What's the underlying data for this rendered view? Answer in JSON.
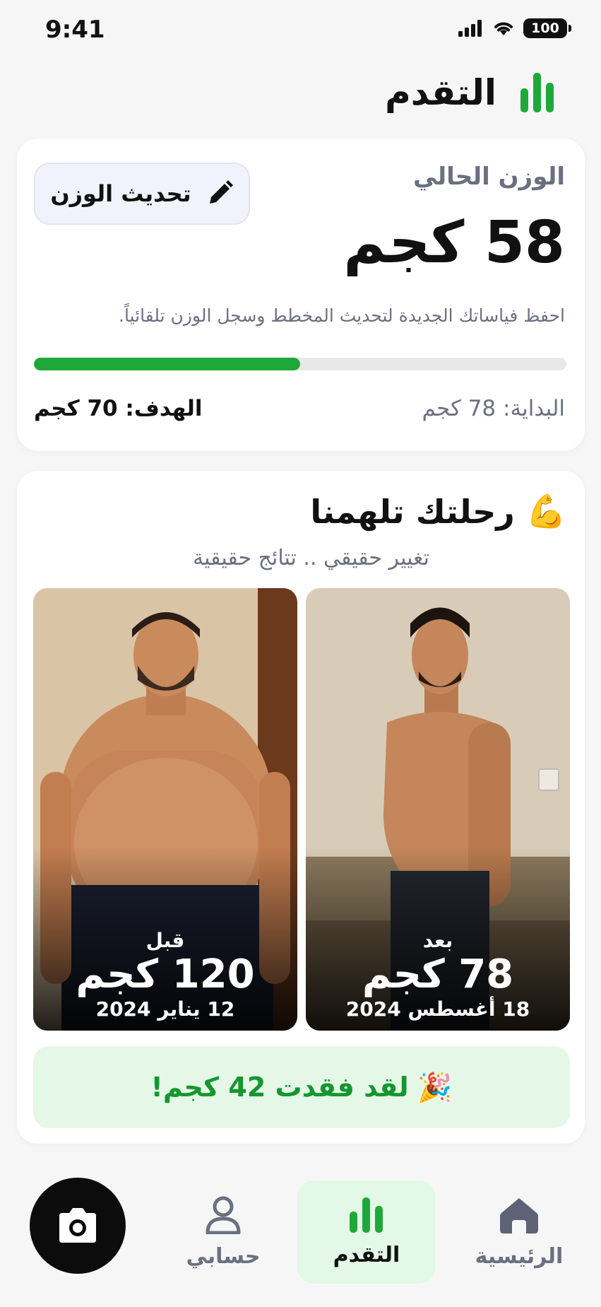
{
  "status_bar": {
    "time": "9:41",
    "battery": "100"
  },
  "header": {
    "title": "التقدم",
    "icon": "bar-chart-icon"
  },
  "weight_card": {
    "current_label": "الوزن الحالي",
    "current_value": "58 كجم",
    "update_button": "تحديث الوزن",
    "description": "احفظ فياساتك الجديدة لتحديث المخطط وسجل الوزن تلقائياً.",
    "progress_percent": 50,
    "start_text": "البداية: 78 كجم",
    "goal_text": "الهدف: 70 كجم"
  },
  "journey": {
    "title": "رحلتك تلهمنا",
    "title_emoji": "💪",
    "subtitle": "تغيير حقيقي .. تتائج حقيقية",
    "before": {
      "label": "قبل",
      "weight": "120 كجم",
      "date": "12 يناير 2024"
    },
    "after": {
      "label": "بعد",
      "weight": "78 كجم",
      "date": "18 أغسطس 2024"
    },
    "banner_text": "لقد فقدت 42 كجم!",
    "banner_emoji": "🎉"
  },
  "bottom_nav": {
    "items": [
      {
        "label": "الرئيسية",
        "icon": "home-icon"
      },
      {
        "label": "التقدم",
        "icon": "bar-chart-icon",
        "active": true
      },
      {
        "label": "حسابي",
        "icon": "user-icon"
      }
    ],
    "camera_icon": "camera-icon"
  },
  "colors": {
    "accent": "#1fa83a",
    "banner_bg": "#e5f8e8",
    "banner_text": "#15962f"
  }
}
